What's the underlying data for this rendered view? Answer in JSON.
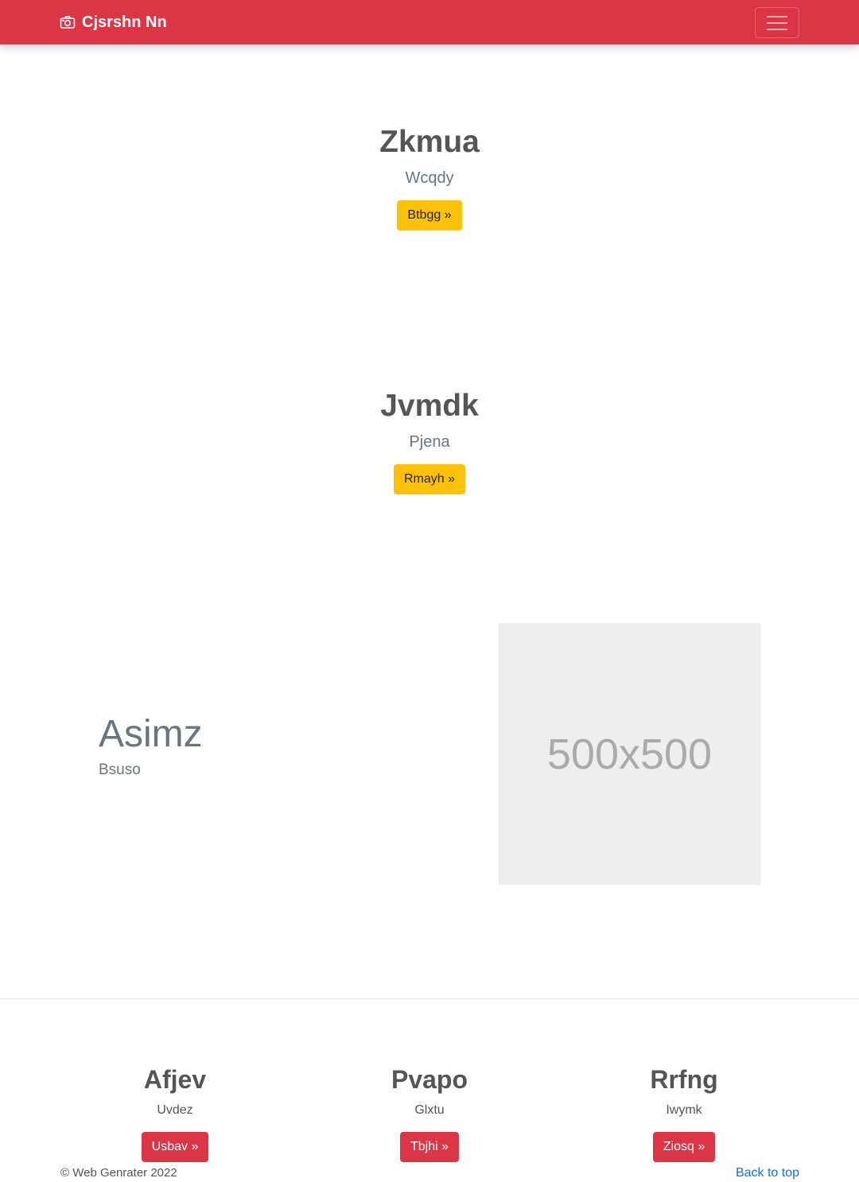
{
  "navbar": {
    "brand_icon": "camera-icon",
    "brand": "Cjsrshn Nn",
    "toggler_icon": "hamburger-icon"
  },
  "hero1": {
    "title": "Zkmua",
    "subtitle": "Wcqdy",
    "button": "Btbgg »"
  },
  "hero2": {
    "title": "Jvmdk",
    "subtitle": "Pjena",
    "button": "Rmayh »"
  },
  "feature": {
    "title": "Asimz",
    "subtitle": "Bsuso",
    "image_text": "500x500"
  },
  "columns": [
    {
      "title": "Afjev",
      "text": "Uvdez",
      "button": "Usbav »"
    },
    {
      "title": "Pvapo",
      "text": "Glxtu",
      "button": "Tbjhi »"
    },
    {
      "title": "Rrfng",
      "text": "Iwymk",
      "button": "Ziosq »"
    }
  ],
  "footer": {
    "copyright": "© Web Genrater 2022",
    "back_to_top": "Back to top"
  },
  "colors": {
    "primary": "#dc3545",
    "warning": "#ffc107",
    "link": "#0d6efd"
  }
}
